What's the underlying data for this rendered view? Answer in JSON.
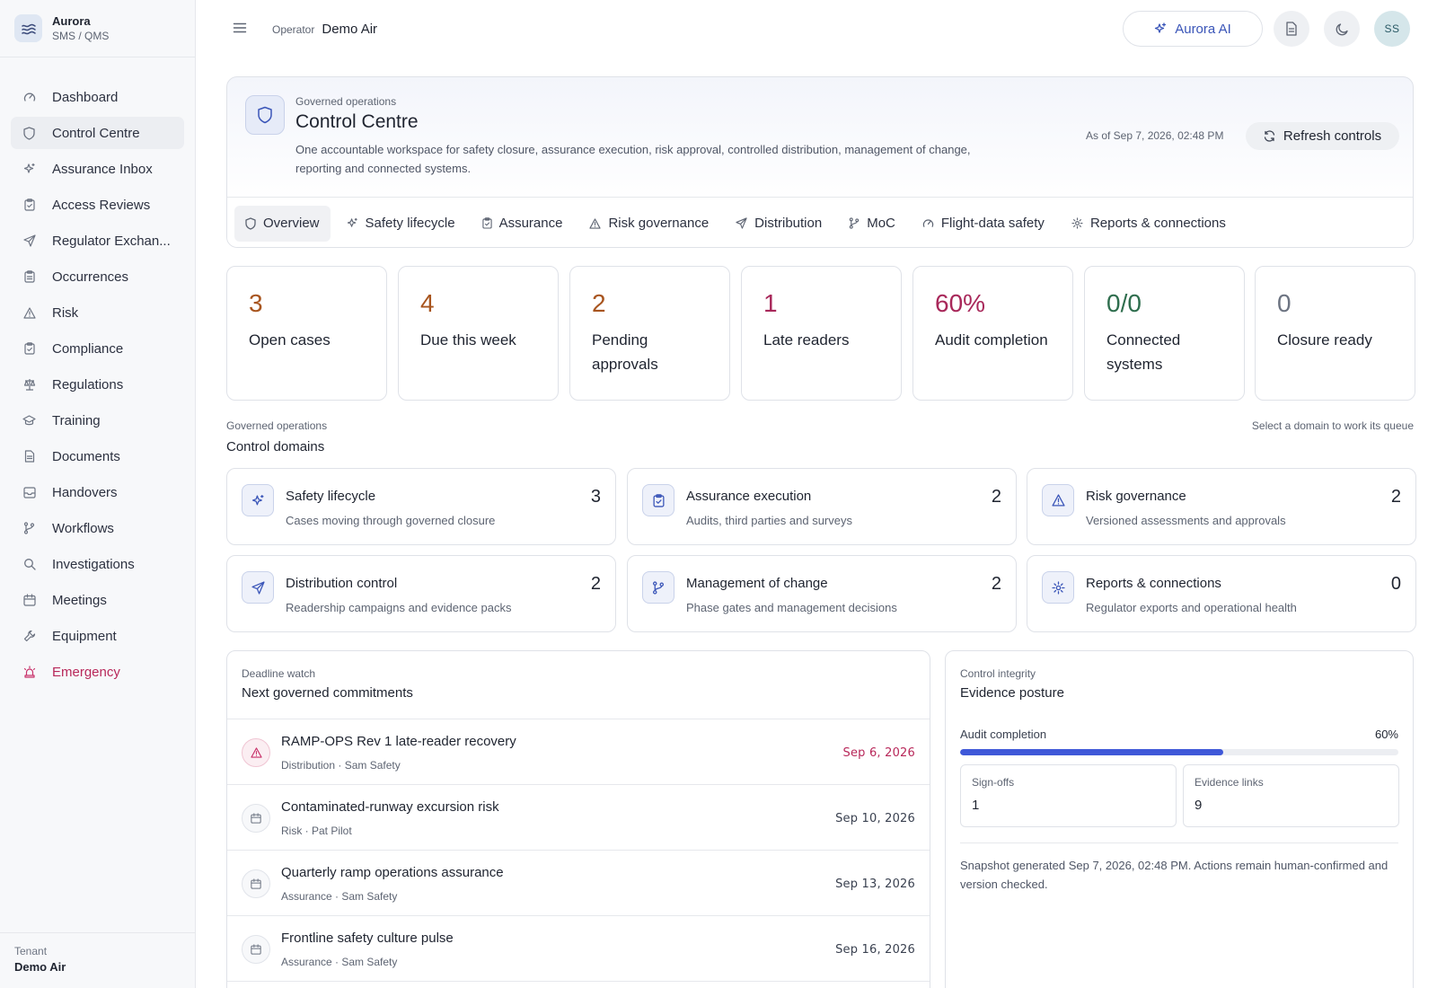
{
  "brand": {
    "name": "Aurora",
    "sub": "SMS / QMS"
  },
  "sidebar": {
    "items": [
      {
        "label": "Dashboard",
        "icon": "dashboard-icon"
      },
      {
        "label": "Control Centre",
        "icon": "shield-icon"
      },
      {
        "label": "Assurance Inbox",
        "icon": "sparkle-icon"
      },
      {
        "label": "Access Reviews",
        "icon": "clipboard-check-icon"
      },
      {
        "label": "Regulator Exchan...",
        "icon": "send-icon"
      },
      {
        "label": "Occurrences",
        "icon": "clipboard-icon"
      },
      {
        "label": "Risk",
        "icon": "warning-icon"
      },
      {
        "label": "Compliance",
        "icon": "clipboard-check-icon"
      },
      {
        "label": "Regulations",
        "icon": "scale-icon"
      },
      {
        "label": "Training",
        "icon": "graduation-cap-icon"
      },
      {
        "label": "Documents",
        "icon": "document-icon"
      },
      {
        "label": "Handovers",
        "icon": "inbox-icon"
      },
      {
        "label": "Workflows",
        "icon": "branch-icon"
      },
      {
        "label": "Investigations",
        "icon": "search-icon"
      },
      {
        "label": "Meetings",
        "icon": "calendar-icon"
      },
      {
        "label": "Equipment",
        "icon": "wrench-icon"
      },
      {
        "label": "Emergency",
        "icon": "siren-icon"
      }
    ],
    "tenant_label": "Tenant",
    "tenant_name": "Demo Air"
  },
  "topbar": {
    "operator_label": "Operator",
    "operator_name": "Demo Air",
    "ai_label": "Aurora AI",
    "avatar_initials": "SS"
  },
  "header": {
    "kicker": "Governed operations",
    "title": "Control Centre",
    "description": "One accountable workspace for safety closure, assurance execution, risk approval, controlled distribution, management of change, reporting and connected systems.",
    "as_of": "As of Sep 7, 2026, 02:48 PM",
    "refresh_label": "Refresh controls",
    "tabs": [
      {
        "label": "Overview",
        "icon": "shield-icon"
      },
      {
        "label": "Safety lifecycle",
        "icon": "sparkle-icon"
      },
      {
        "label": "Assurance",
        "icon": "clipboard-check-icon"
      },
      {
        "label": "Risk governance",
        "icon": "warning-icon"
      },
      {
        "label": "Distribution",
        "icon": "send-icon"
      },
      {
        "label": "MoC",
        "icon": "branch-icon"
      },
      {
        "label": "Flight-data safety",
        "icon": "dashboard-icon"
      },
      {
        "label": "Reports & connections",
        "icon": "gear-icon"
      }
    ]
  },
  "kpis": [
    {
      "value": "3",
      "label": "Open cases",
      "color": "#a8551f"
    },
    {
      "value": "4",
      "label": "Due this week",
      "color": "#a8551f"
    },
    {
      "value": "2",
      "label": "Pending approvals",
      "color": "#a8551f"
    },
    {
      "value": "1",
      "label": "Late readers",
      "color": "#a8285a"
    },
    {
      "value": "60%",
      "label": "Audit completion",
      "color": "#a8285a"
    },
    {
      "value": "0/0",
      "label": "Connected systems",
      "color": "#2f6e4e"
    },
    {
      "value": "0",
      "label": "Closure ready",
      "color": "#6d7482"
    }
  ],
  "domains_section": {
    "kicker": "Governed operations",
    "title": "Control domains",
    "hint": "Select a domain to work its queue",
    "items": [
      {
        "title": "Safety lifecycle",
        "sub": "Cases moving through governed closure",
        "count": "3",
        "icon": "sparkle-icon"
      },
      {
        "title": "Assurance execution",
        "sub": "Audits, third parties and surveys",
        "count": "2",
        "icon": "clipboard-check-icon"
      },
      {
        "title": "Risk governance",
        "sub": "Versioned assessments and approvals",
        "count": "2",
        "icon": "warning-icon"
      },
      {
        "title": "Distribution control",
        "sub": "Readership campaigns and evidence packs",
        "count": "2",
        "icon": "send-icon"
      },
      {
        "title": "Management of change",
        "sub": "Phase gates and management decisions",
        "count": "2",
        "icon": "branch-icon"
      },
      {
        "title": "Reports & connections",
        "sub": "Regulator exports and operational health",
        "count": "0",
        "icon": "gear-icon"
      }
    ]
  },
  "deadlines": {
    "kicker": "Deadline watch",
    "title": "Next governed commitments",
    "items": [
      {
        "title": "RAMP-OPS Rev 1 late-reader recovery",
        "meta": "Distribution · Sam Safety",
        "date": "Sep 6, 2026",
        "overdue": true
      },
      {
        "title": "Contaminated-runway excursion risk",
        "meta": "Risk · Pat Pilot",
        "date": "Sep 10, 2026",
        "overdue": false
      },
      {
        "title": "Quarterly ramp operations assurance",
        "meta": "Assurance · Sam Safety",
        "date": "Sep 13, 2026",
        "overdue": false
      },
      {
        "title": "Frontline safety culture pulse",
        "meta": "Assurance · Sam Safety",
        "date": "Sep 16, 2026",
        "overdue": false
      }
    ]
  },
  "evidence": {
    "kicker": "Control integrity",
    "title": "Evidence posture",
    "audit_label": "Audit completion",
    "audit_pct": "60%",
    "audit_fraction": 0.6,
    "signoffs_label": "Sign-offs",
    "signoffs_value": "1",
    "links_label": "Evidence links",
    "links_value": "9",
    "note": "Snapshot generated Sep 7, 2026, 02:48 PM. Actions remain human-confirmed and version checked."
  },
  "colors": {
    "accent": "#3f58d8",
    "danger": "#b8285a",
    "warning": "#a8551f",
    "success": "#2f6e4e"
  }
}
